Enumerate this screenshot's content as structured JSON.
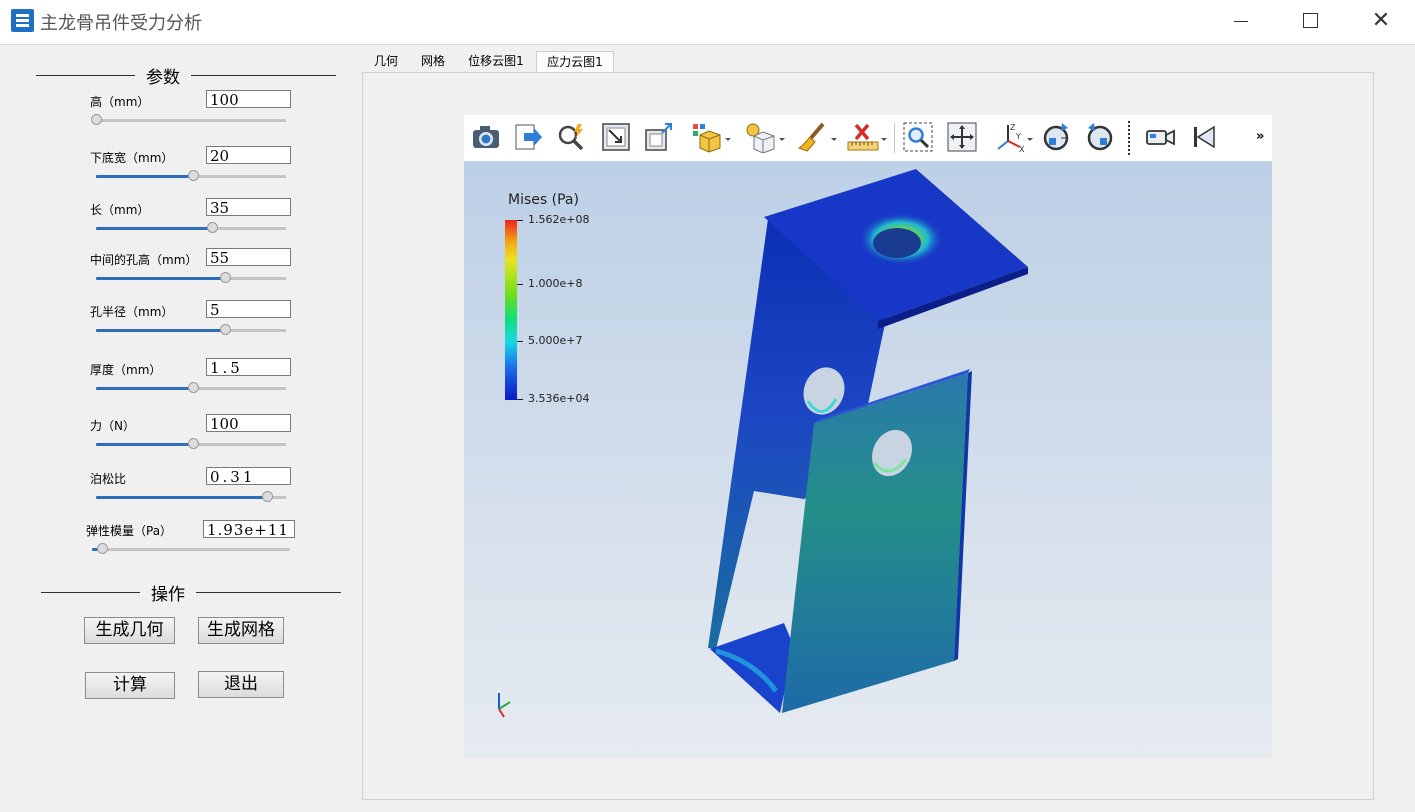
{
  "window": {
    "title": "主龙骨吊件受力分析",
    "close_glyph": "✕"
  },
  "params_group": {
    "title": "参数"
  },
  "params": [
    {
      "label": "高（mm）",
      "value": "100",
      "slider": 0.0
    },
    {
      "label": "下底宽（mm）",
      "value": "20",
      "slider": 0.51
    },
    {
      "label": "长（mm）",
      "value": "35",
      "slider": 0.61
    },
    {
      "label": "中间的孔高（mm）",
      "value": "55",
      "slider": 0.68
    },
    {
      "label": "孔半径（mm）",
      "value": "5",
      "slider": 0.68
    },
    {
      "label": "厚度（mm）",
      "value": "1.5",
      "slider": 0.51
    },
    {
      "label": "力（N）",
      "value": "100",
      "slider": 0.51
    },
    {
      "label": "泊松比",
      "value": "0.31",
      "slider": 0.9
    },
    {
      "label": "弹性模量（Pa）",
      "value": "1.93e+11",
      "slider": 0.05
    }
  ],
  "ops_group": {
    "title": "操作"
  },
  "buttons": {
    "gen_geometry": "生成几何",
    "gen_mesh": "生成网格",
    "compute": "计算",
    "exit": "退出"
  },
  "tabs": [
    {
      "label": "几何",
      "active": false
    },
    {
      "label": "网格",
      "active": false
    },
    {
      "label": "位移云图1",
      "active": false
    },
    {
      "label": "应力云图1",
      "active": true
    }
  ],
  "toolbar": {
    "icons": [
      "camera-icon",
      "export-icon",
      "query-icon",
      "frame-icon",
      "resize-icon",
      "color-cube-icon",
      "light-cube-icon",
      "brush-icon",
      "ruler-delete-icon",
      "zoom-box-icon",
      "pan-icon",
      "axes-icon",
      "rotate-cw-icon",
      "rotate-ccw-icon",
      "video-camera-icon",
      "first-frame-icon"
    ],
    "more": "»"
  },
  "legend": {
    "title": "Mises (Pa)",
    "ticks": [
      {
        "label": "1.562e+08",
        "value": 156200000.0
      },
      {
        "label": "1.000e+8",
        "value": 100000000.0
      },
      {
        "label": "5.000e+7",
        "value": 50000000.0
      },
      {
        "label": "3.536e+04",
        "value": 35360.0
      }
    ],
    "min": 35360.0,
    "max": 156200000.0
  },
  "colors": {
    "accent": "#2e6ebd",
    "viewport_top": "#bdd0e6",
    "viewport_bottom": "#e6ebf0",
    "app_icon": "#1f6fc5"
  }
}
